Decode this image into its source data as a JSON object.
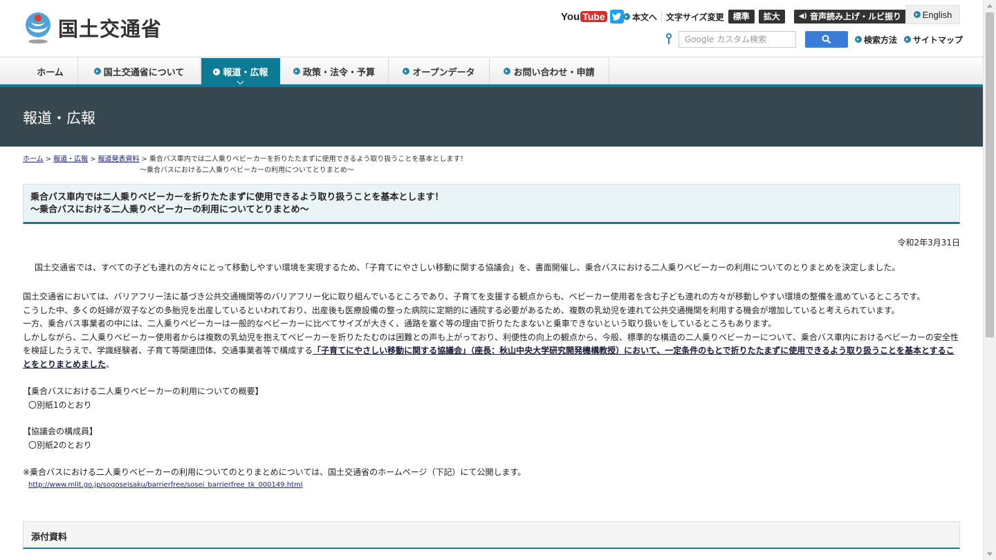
{
  "header": {
    "logo_text": "国土交通省",
    "social": {
      "youtube_you": "You",
      "youtube_tube": "Tube",
      "twitter": "twitter-icon"
    },
    "utility": {
      "skip_to_content": "本文へ",
      "font_size_label": "文字サイズ変更",
      "font_standard": "標準",
      "font_large": "拡大",
      "voice": "音声読み上げ・ルビ振り",
      "english": "English"
    },
    "search": {
      "placeholder": "Google カスタム検索",
      "how_to": "検索方法",
      "sitemap": "サイトマップ"
    }
  },
  "nav": {
    "items": [
      {
        "label": "ホーム"
      },
      {
        "label": "国土交通省について"
      },
      {
        "label": "報道・広報"
      },
      {
        "label": "政策・法令・予算"
      },
      {
        "label": "オープンデータ"
      },
      {
        "label": "お問い合わせ・申請"
      }
    ]
  },
  "banner": {
    "title": "報道・広報"
  },
  "breadcrumb": {
    "home": "ホーム",
    "press": "報道・広報",
    "releases": "報道発表資料",
    "current_line1": "乗合バス車内では二人乗りベビーカーを折りたたまずに使用できるよう取り扱うことを基本とします！",
    "current_line2": "～乗合バスにおける二人乗りベビーカーの利用についてとりまとめ～"
  },
  "article": {
    "title_line1": "乗合バス車内では二人乗りベビーカーを折りたたまずに使用できるよう取り扱うことを基本とします！",
    "title_line2": "～乗合バスにおける二人乗りベビーカーの利用についてとりまとめ～",
    "date": "令和2年3月31日",
    "para1": "国土交通省では、すべての子ども連れの方々にとって移動しやすい環境を実現するため、「子育てにやさしい移動に関する協議会」を、書面開催し、乗合バスにおける二人乗りベビーカーの利用についてのとりまとめを決定しました。",
    "para2_l1": " 国土交通省においては、バリアフリー法に基づき公共交通機関等のバリアフリー化に取り組んでいるところであり、子育てを支援する観点からも、ベビーカー使用者を含む子ども連れの方々が移動しやすい環境の整備を進めているところです。",
    "para2_l2": " こうした中、多くの妊婦が双子などの多胎児を出産しているといわれており、出産後も医療設備の整った病院に定期的に通院する必要があるため、複数の乳幼児を連れて公共交通機関を利用する機会が増加していると考えられています。",
    "para2_l3": " 一方、乗合バス事業者の中には、二人乗りベビーカーは一般的なベビーカーに比べてサイズが大きく、通路を塞ぐ等の理由で折りたたまないと乗車できないという取り扱いをしているところもあります。",
    "para2_l4": " しかしながら、二人乗りベビーカー使用者からは複数の乳幼児を抱えてベビーカーを折りたたむのは困難との声も上がっており、利便性の向上の観点から、今般、標準的な構造の二人乗りベビーカーについて、乗合バス車内におけるベビーカーの安全性を検証したうえで、学識経験者、子育て等関連団体、交通事業者等で構成する",
    "para2_emph": "「子育てにやさしい移動に関する協議会」（座長：秋山中央大学研究開発機構教授）において、一定条件のもとで折りたたまずに使用できるよう取り扱うことを基本とすることをとりまとめました",
    "para2_end": "。",
    "summary_heading": "【乗合バスにおける二人乗りベビーカーの利用についての概要】",
    "summary_item": "〇別紙1のとおり",
    "members_heading": "【協議会の構成員】",
    "members_item": "〇別紙2のとおり",
    "note": "※乗合バスにおける二人乗りベビーカーの利用についてのとりまとめについては、国土交通省のホームページ（下記）にて公開します。",
    "url": "http://www.mlit.go.jp/sogoseisaku/barrierfree/sosei_barrierfree_tk_000149.html",
    "attachments_heading": "添付資料"
  },
  "colors": {
    "accent": "#0f7a94",
    "banner": "#37474f",
    "search_button": "#3a7cd7"
  }
}
